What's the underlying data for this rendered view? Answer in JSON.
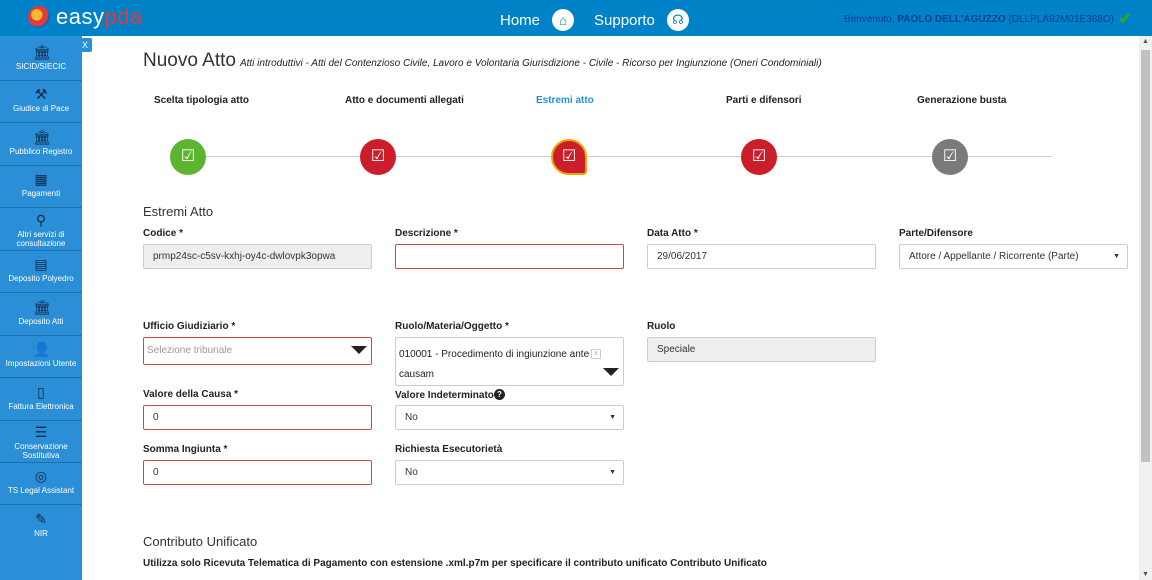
{
  "header": {
    "logo_prefix": "easy",
    "logo_suffix": "pda",
    "home_label": "Home",
    "support_label": "Supporto",
    "welcome_prefix": "Benvenuto,",
    "user_name": "PAOLO DELL'AGUZZO",
    "user_code": "(DLLPLA92M01E388O)",
    "status_icon": "check-icon"
  },
  "sidebar": {
    "close_label": "X",
    "items": [
      {
        "label": "SICID/SIECIC",
        "icon": "court-icon"
      },
      {
        "label": "Giudice di Pace",
        "icon": "gavel-icon"
      },
      {
        "label": "Pubblico Registro",
        "icon": "building-icon"
      },
      {
        "label": "Pagamenti",
        "icon": "calculator-icon"
      },
      {
        "label": "Altri servizi di consultazione",
        "icon": "search-icon"
      },
      {
        "label": "Deposito Polyedro",
        "icon": "archive-icon"
      },
      {
        "label": "Deposito Atti",
        "icon": "court-icon"
      },
      {
        "label": "Impostazioni Utente",
        "icon": "user-settings-icon"
      },
      {
        "label": "Fattura Elettronica",
        "icon": "phone-icon"
      },
      {
        "label": "Conservazione Sostitutiva",
        "icon": "database-icon"
      },
      {
        "label": "TS Legal Assistant",
        "icon": "assistant-icon"
      },
      {
        "label": "NIR",
        "icon": "edit-icon"
      }
    ]
  },
  "page": {
    "title": "Nuovo Atto",
    "subtitle": "Atti introduttivi - Atti del Contenzioso Civile, Lavoro e Volontaria Giurisdizione - Civile - Ricorso per Ingiunzione (Oneri Condominiali)"
  },
  "steps": [
    {
      "label": "Scelta tipologia atto",
      "state": "done"
    },
    {
      "label": "Atto e documenti allegati",
      "state": "error"
    },
    {
      "label": "Estremi atto",
      "state": "active"
    },
    {
      "label": "Parti e difensori",
      "state": "error"
    },
    {
      "label": "Generazione busta",
      "state": "pending"
    }
  ],
  "estremi": {
    "section_title": "Estremi Atto",
    "codice_label": "Codice *",
    "codice_value": "prmp24sc-c5sv-kxhj-oy4c-dwlovpk3opwa",
    "descrizione_label": "Descrizione *",
    "descrizione_value": "",
    "data_label": "Data Atto *",
    "data_value": "29/06/2017",
    "parte_label": "Parte/Difensore",
    "parte_value": "Attore / Appellante / Ricorrente (Parte)",
    "ufficio_label": "Ufficio Giudiziario *",
    "ufficio_placeholder": "Selezione tribunale",
    "ruolo_materia_label": "Ruolo/Materia/Oggetto *",
    "ruolo_materia_value_line1": "010001 - Procedimento di ingiunzione ante",
    "ruolo_materia_value_line2": "causam",
    "ruolo_label": "Ruolo",
    "ruolo_value": "Speciale",
    "valore_causa_label": "Valore della Causa *",
    "valore_causa_value": "0",
    "valore_indet_label": "Valore Indeterminato",
    "valore_indet_value": "No",
    "somma_label": "Somma Ingiunta *",
    "somma_value": "0",
    "esecutorieta_label": "Richiesta Esecutorietà",
    "esecutorieta_value": "No"
  },
  "contributo": {
    "section_title": "Contributo Unificato",
    "note": "Utilizza solo Ricevuta Telematica di Pagamento con estensione .xml.p7m per specificare il contributo unificato Contributo Unificato"
  },
  "colors": {
    "topbar": "#0082c8",
    "sidebar": "#2a8fd6",
    "done": "#5bb530",
    "error": "#cc1e2a",
    "pending": "#7a7a7a",
    "active_border": "#f0a400"
  }
}
